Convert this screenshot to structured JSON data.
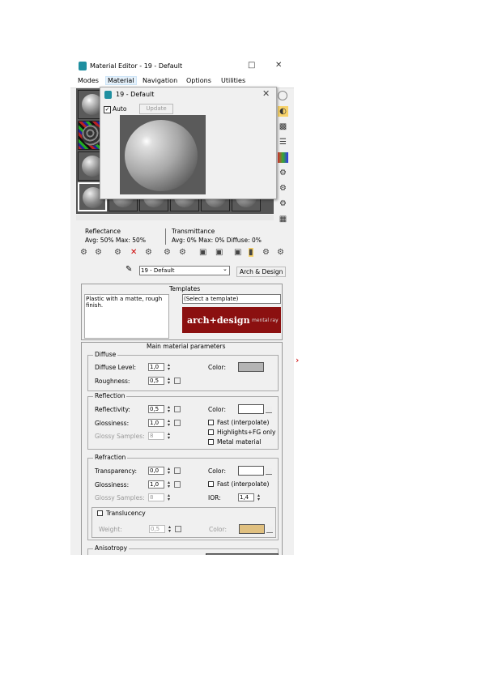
{
  "window": {
    "title": "Material Editor - 19 - Default",
    "minimize_glyph": "□",
    "close_glyph": "✕"
  },
  "menubar": {
    "items": [
      {
        "label": "Modes"
      },
      {
        "label": "Material"
      },
      {
        "label": "Navigation"
      },
      {
        "label": "Options"
      },
      {
        "label": "Utilities"
      }
    ]
  },
  "sample_slots": {
    "rows": [
      [
        "sphere",
        "sphere",
        "sphere"
      ],
      [
        "sphere-checker",
        "sphere",
        "sphere"
      ],
      [
        "sphere",
        "sphere",
        "sphere"
      ],
      [
        "sphere",
        "sphere",
        "sphere"
      ]
    ]
  },
  "side_tools": [
    {
      "icon": "sample-type-icon"
    },
    {
      "icon": "backlight-icon"
    },
    {
      "icon": "background-icon"
    },
    {
      "icon": "uv-tiling-icon"
    },
    {
      "icon": "video-color-check-icon"
    },
    {
      "icon": "make-preview-icon"
    },
    {
      "icon": "options-icon"
    },
    {
      "icon": "select-by-material-icon"
    },
    {
      "icon": "material-navigator-icon"
    }
  ],
  "popup": {
    "title": "19 - Default",
    "close_glyph": "✕",
    "auto_label": "Auto",
    "auto_checked_glyph": "✓",
    "update_label": "Update"
  },
  "stats": {
    "reflectance_label": "Reflectance",
    "reflectance_values": "Avg:  50% Max:  50%",
    "transmittance_label": "Transmittance",
    "transmittance_values": "Avg:   0% Max:   0%  Diffuse:   0%"
  },
  "name_bar": {
    "material_name": "19 - Default",
    "material_type": "Arch & Design"
  },
  "templates": {
    "header": "Templates",
    "description": "Plastic with a matte, rough finish.",
    "select_placeholder": "(Select a template)",
    "logo_text": "arch+design",
    "logo_subtext": "mental ray"
  },
  "main_params": {
    "header": "Main material parameters",
    "diffuse": {
      "group": "Diffuse",
      "level_label": "Diffuse Level:",
      "level_value": "1,0",
      "roughness_label": "Roughness:",
      "roughness_value": "0,5",
      "color_label": "Color:",
      "color": "#b4b4b4"
    },
    "reflection": {
      "group": "Reflection",
      "reflectivity_label": "Reflectivity:",
      "reflectivity_value": "0,5",
      "glossiness_label": "Glossiness:",
      "glossiness_value": "1,0",
      "glossy_samples_label": "Glossy Samples:",
      "glossy_samples_value": "8",
      "color_label": "Color:",
      "color": "#ffffff",
      "fast_label": "Fast (interpolate)",
      "highlights_label": "Highlights+FG only",
      "metal_label": "Metal material"
    },
    "refraction": {
      "group": "Refraction",
      "transparency_label": "Transparency:",
      "transparency_value": "0,0",
      "glossiness_label": "Glossiness:",
      "glossiness_value": "1,0",
      "glossy_samples_label": "Glossy Samples:",
      "glossy_samples_value": "8",
      "color_label": "Color:",
      "color": "#ffffff",
      "fast_label": "Fast (interpolate)",
      "ior_label": "IOR:",
      "ior_value": "1,4",
      "translucency_label": "Translucency",
      "weight_label": "Weight:",
      "weight_value": "0,5",
      "trans_color_label": "Color:",
      "trans_color": "#e0c080"
    },
    "anisotropy": {
      "group": "Anisotropy"
    }
  },
  "scroll_arrow": "›",
  "right_arrow": "›"
}
